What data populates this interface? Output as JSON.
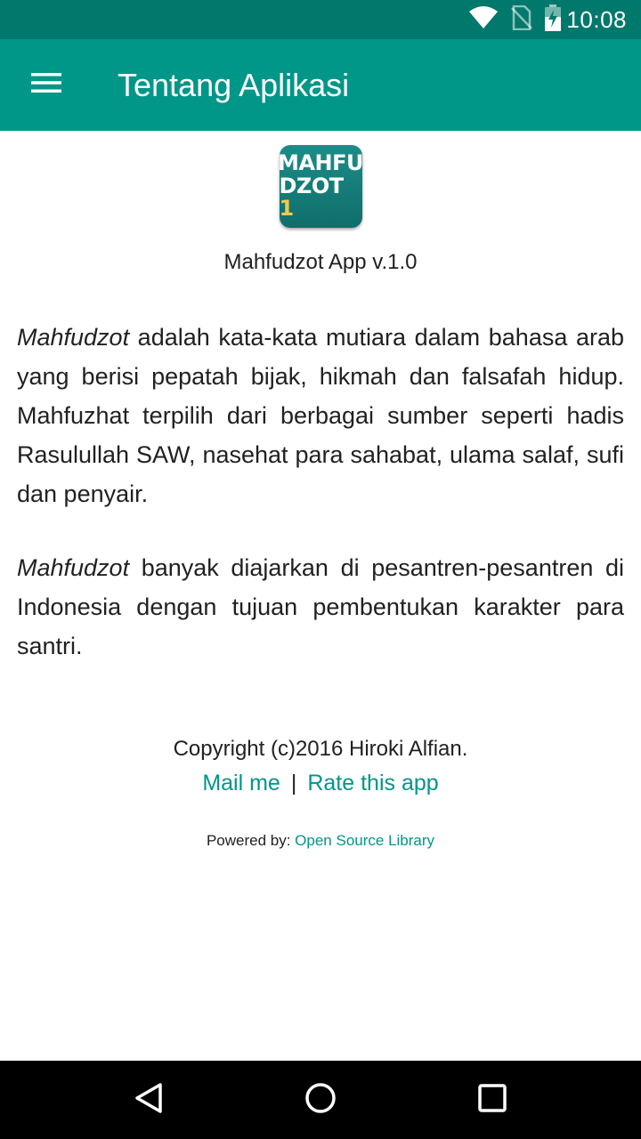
{
  "status_bar": {
    "time": "10:08",
    "icons": [
      "wifi-icon",
      "no-sim-icon",
      "battery-charging-icon"
    ]
  },
  "app_bar": {
    "menu_icon": "hamburger-menu-icon",
    "title": "Tentang Aplikasi"
  },
  "logo": {
    "line1": "MAHFU",
    "line2_text": "DZOT",
    "line2_num": "1"
  },
  "app_version": "Mahfudzot App v.1.0",
  "paragraphs": {
    "p1_em": "Mahfudzot",
    "p1_rest": " adalah kata-kata mutiara dalam bahasa arab yang berisi pepatah bijak, hikmah dan falsafah hidup. Mahfuzhat terpilih dari berbagai sumber seperti hadis Rasulullah SAW, nasehat para sahabat, ulama salaf, sufi dan penyair.",
    "p2_em": "Mahfudzot",
    "p2_rest": " banyak diajarkan di pesantren-pesantren di Indonesia dengan tujuan pembentukan karakter para santri."
  },
  "footer": {
    "copyright": "Copyright (c)2016 Hiroki Alfian.",
    "mail_link": "Mail me",
    "separator": "|",
    "rate_link": "Rate this app",
    "powered_label": "Powered by: ",
    "powered_link": "Open Source Library"
  },
  "nav_bar": {
    "icons": [
      "back-icon",
      "home-icon",
      "recents-icon"
    ]
  },
  "colors": {
    "status_bar": "#00786b",
    "app_bar": "#009688",
    "accent_link": "#009688",
    "text": "#212121"
  }
}
